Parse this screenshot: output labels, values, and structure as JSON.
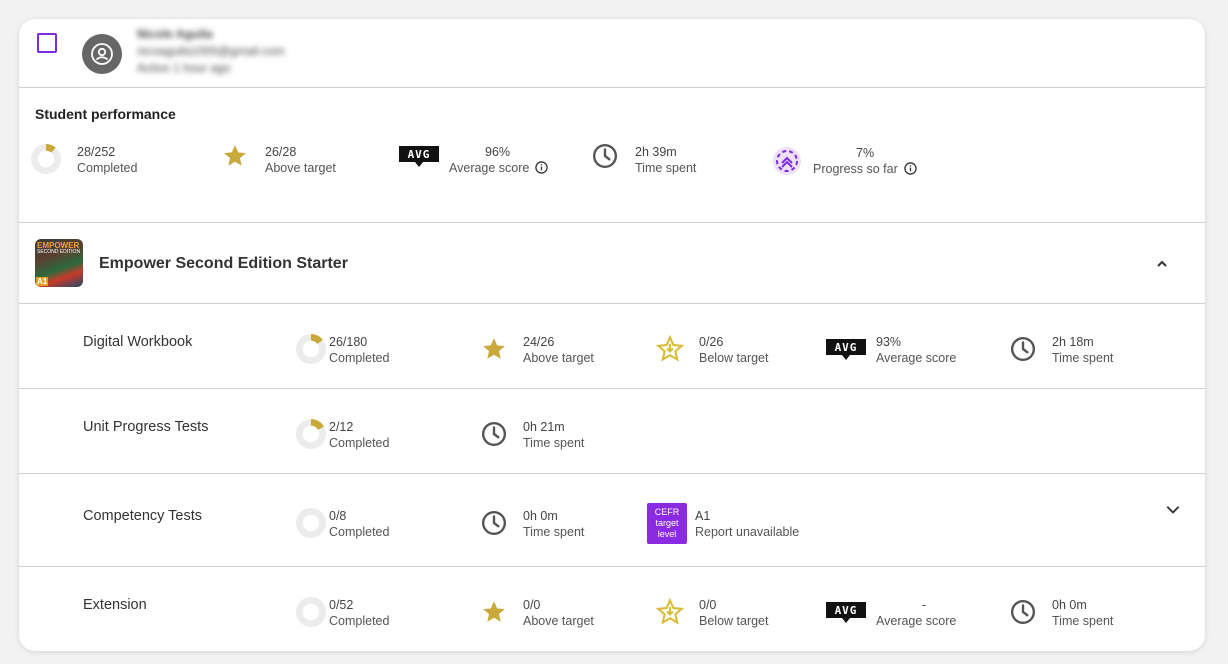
{
  "student": {
    "name": "Nicole Aguila",
    "email": "nicoaguila1005@gmail.com",
    "active": "Active 1 hour ago"
  },
  "performance": {
    "title": "Student performance",
    "completed": {
      "value": "28/252",
      "label": "Completed",
      "fraction": 0.111
    },
    "above": {
      "value": "26/28",
      "label": "Above target"
    },
    "avg": {
      "badge": "AVG",
      "value": "96%",
      "label": "Average score"
    },
    "time": {
      "value": "2h 39m",
      "label": "Time spent"
    },
    "progress": {
      "value": "7%",
      "label": "Progress so far"
    }
  },
  "course": {
    "title": "Empower Second Edition Starter",
    "cover": {
      "title": "EMPOWER",
      "subtitle": "SECOND EDITION",
      "level": "A1"
    }
  },
  "rows": {
    "workbook": {
      "title": "Digital Workbook",
      "completed": {
        "value": "26/180",
        "label": "Completed",
        "fraction": 0.144
      },
      "above": {
        "value": "24/26",
        "label": "Above target"
      },
      "below": {
        "value": "0/26",
        "label": "Below target"
      },
      "avg": {
        "badge": "AVG",
        "value": "93%",
        "label": "Average score"
      },
      "time": {
        "value": "2h 18m",
        "label": "Time spent"
      }
    },
    "unit": {
      "title": "Unit Progress Tests",
      "completed": {
        "value": "2/12",
        "label": "Completed",
        "fraction": 0.167
      },
      "time": {
        "value": "0h 21m",
        "label": "Time spent"
      }
    },
    "competency": {
      "title": "Competency Tests",
      "completed": {
        "value": "0/8",
        "label": "Completed",
        "fraction": 0
      },
      "time": {
        "value": "0h 0m",
        "label": "Time spent"
      },
      "cefr": {
        "badge_line1": "CEFR",
        "badge_line2": "target",
        "badge_line3": "level",
        "value": "A1",
        "label": "Report unavailable"
      }
    },
    "extension": {
      "title": "Extension",
      "completed": {
        "value": "0/52",
        "label": "Completed",
        "fraction": 0
      },
      "above": {
        "value": "0/0",
        "label": "Above target"
      },
      "below": {
        "value": "0/0",
        "label": "Below target"
      },
      "avg": {
        "badge": "AVG",
        "value": "-",
        "label": "Average score"
      },
      "time": {
        "value": "0h 0m",
        "label": "Time spent"
      }
    }
  },
  "colors": {
    "accent": "#7b2be2",
    "gold": "#c9a93a",
    "pie_bg": "#ececec"
  }
}
